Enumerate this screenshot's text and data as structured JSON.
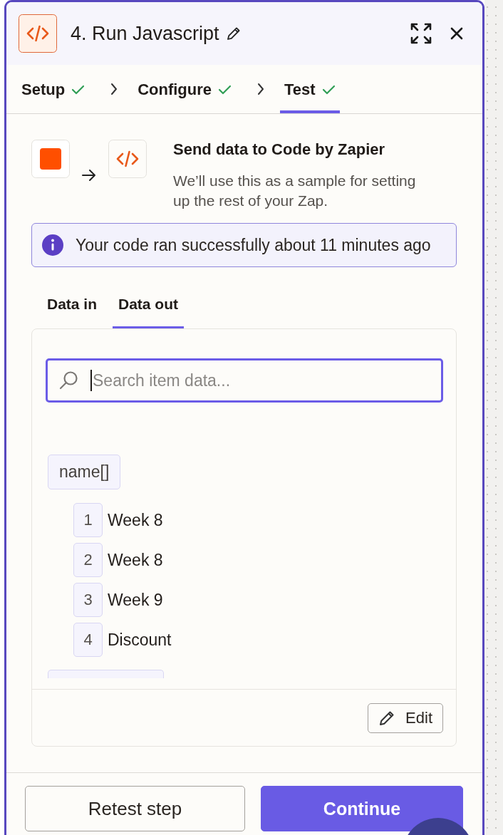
{
  "header": {
    "title": "4. Run Javascript",
    "editable": true
  },
  "steps": [
    {
      "label": "Setup",
      "done": true,
      "selected": false
    },
    {
      "label": "Configure",
      "done": true,
      "selected": false
    },
    {
      "label": "Test",
      "done": true,
      "selected": true
    }
  ],
  "sample": {
    "title": "Send data to Code by Zapier",
    "description": "We’ll use this as a sample for setting up the rest of your Zap."
  },
  "alert": {
    "kind": "info",
    "message": "Your code ran successfully about 11 minutes ago"
  },
  "data_tabs": [
    {
      "label": "Data in",
      "selected": false
    },
    {
      "label": "Data out",
      "selected": true
    }
  ],
  "search": {
    "placeholder": "Search item data...",
    "focused": true
  },
  "fields": [
    {
      "kind": "array",
      "key": "name[]",
      "items": [
        {
          "index": "1",
          "value": "Week 8"
        },
        {
          "index": "2",
          "value": "Week 8"
        },
        {
          "index": "3",
          "value": "Week 9"
        },
        {
          "index": "4",
          "value": "Discount"
        }
      ]
    },
    {
      "kind": "cut_off"
    }
  ],
  "edit_button": "Edit",
  "buttons": [
    {
      "kind": "secondary",
      "label": "Retest step"
    },
    {
      "kind": "primary",
      "label": "Continue"
    }
  ]
}
